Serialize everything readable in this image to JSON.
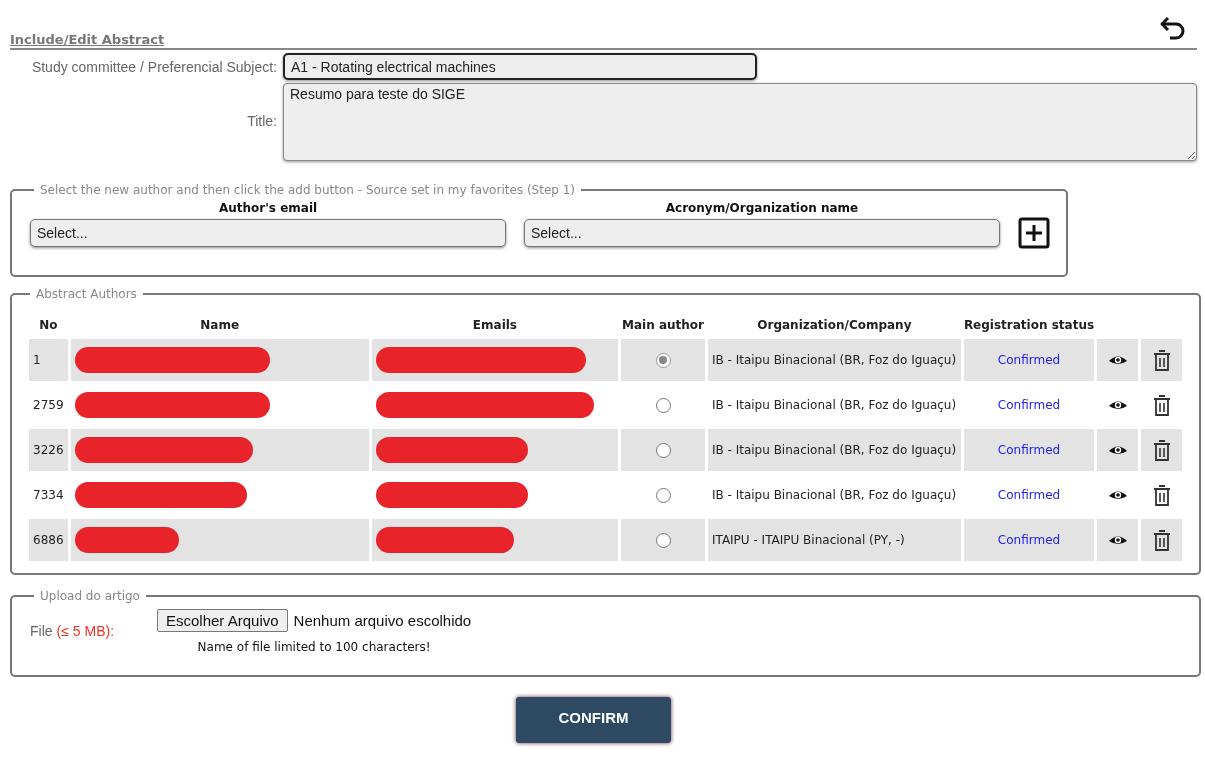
{
  "header": {
    "title": "Include/Edit Abstract"
  },
  "form": {
    "subject": {
      "label": "Study committee / Preferencial Subject:",
      "value": "A1 - Rotating electrical machines"
    },
    "title": {
      "label": "Title:",
      "value": "Resumo para teste do SIGE"
    }
  },
  "add_author": {
    "legend": "Select the new author and then click the add button - Source set in my favorites (Step 1)",
    "email": {
      "label": "Author's email",
      "placeholder": "Select..."
    },
    "organization": {
      "label": "Acronym/Organization name",
      "placeholder": "Select..."
    }
  },
  "authors": {
    "legend": "Abstract Authors",
    "columns": [
      "No",
      "Name",
      "Emails",
      "Main author",
      "Organization/Company",
      "Registration status"
    ],
    "rows": [
      {
        "no": "1",
        "redacted": true,
        "selected": true,
        "organization": "IB - Itaipu Binacional (BR, Foz do Iguaçu)",
        "status": "Confirmed"
      },
      {
        "no": "2759",
        "redacted": true,
        "selected": false,
        "organization": "IB - Itaipu Binacional (BR, Foz do Iguaçu)",
        "status": "Confirmed"
      },
      {
        "no": "3226",
        "redacted": true,
        "selected": false,
        "organization": "IB - Itaipu Binacional (BR, Foz do Iguaçu)",
        "status": "Confirmed"
      },
      {
        "no": "7334",
        "redacted": true,
        "selected": false,
        "organization": "IB - Itaipu Binacional (BR, Foz do Iguaçu)",
        "status": "Confirmed"
      },
      {
        "no": "6886",
        "redacted": true,
        "selected": false,
        "organization": "ITAIPU - ITAIPU Binacional (PY, -)",
        "status": "Confirmed"
      }
    ]
  },
  "upload": {
    "legend": "Upload do artigo",
    "label": "File",
    "limit": "(≤ 5 MB):",
    "button": "Escolher Arquivo",
    "status": "Nenhum arquivo escolhido",
    "hint": "Name of file limited to 100 characters!"
  },
  "confirm": {
    "label": "CONFIRM"
  }
}
